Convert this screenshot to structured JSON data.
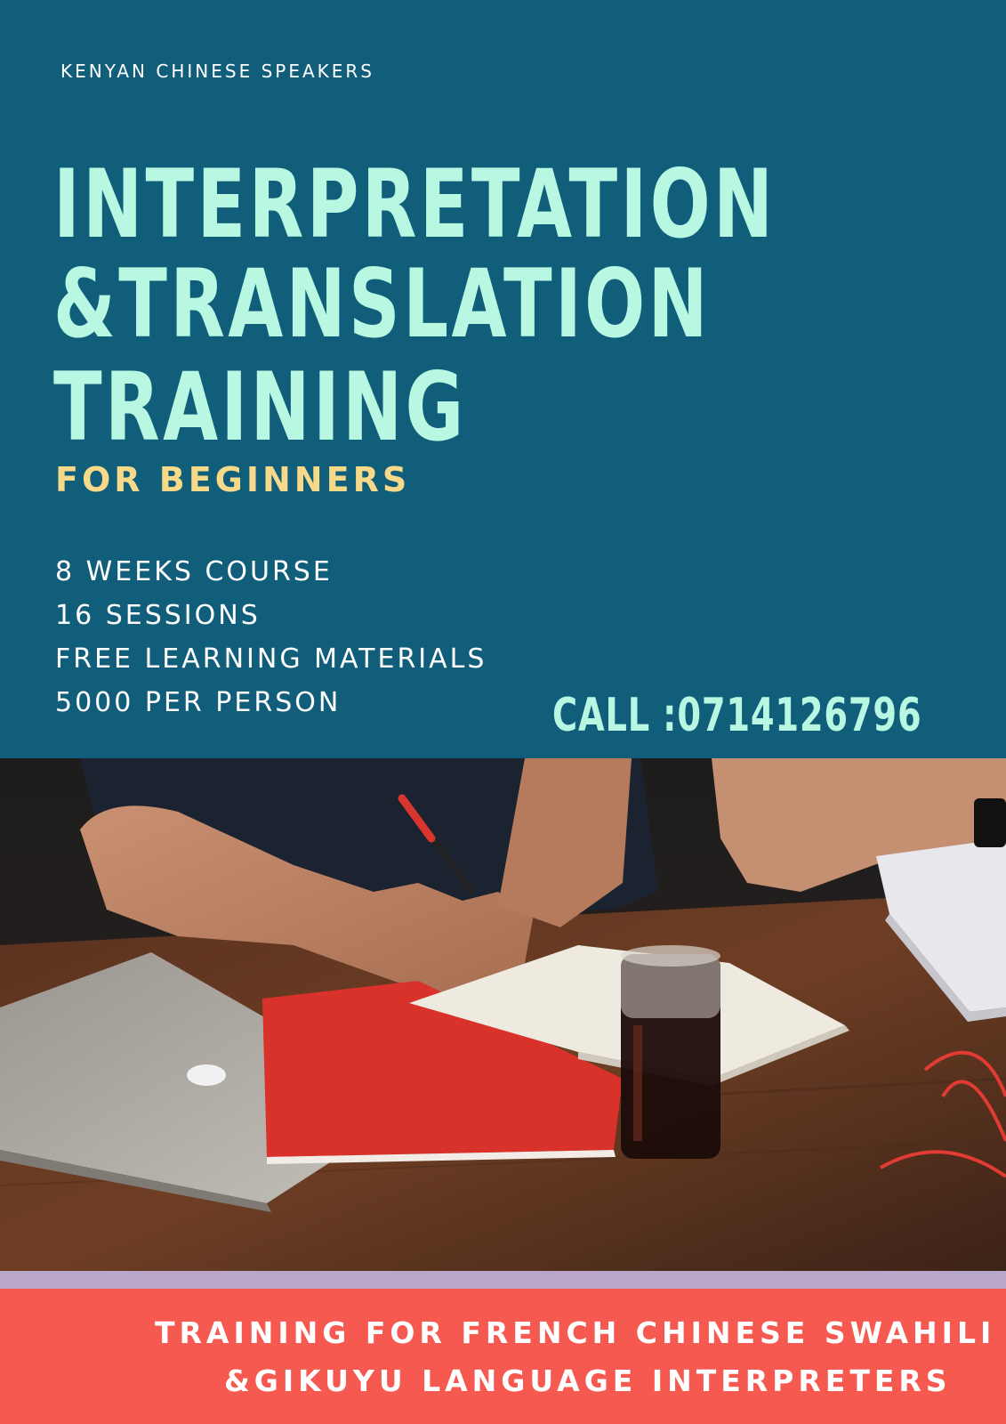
{
  "organization": "KENYAN CHINESE SPEAKERS",
  "title_lines": [
    "INTERPRETATION",
    "&TRANSLATION",
    "TRAINING"
  ],
  "subtitle": "FOR BEGINNERS",
  "details": [
    "8 WEEKS COURSE",
    "16 SESSIONS",
    "FREE LEARNING MATERIALS",
    "5000 PER PERSON"
  ],
  "call": "CALL :0714126796",
  "footer": {
    "line1": "TRAINING  FOR FRENCH CHINESE SWAHILI",
    "line2": "&GIKUYU LANGUAGE INTERPRETERS"
  },
  "colors": {
    "background": "#115e7b",
    "title": "#b8f7e1",
    "subtitle": "#f7d98a",
    "footer": "#f6594f",
    "divider": "#b9a7c9"
  }
}
